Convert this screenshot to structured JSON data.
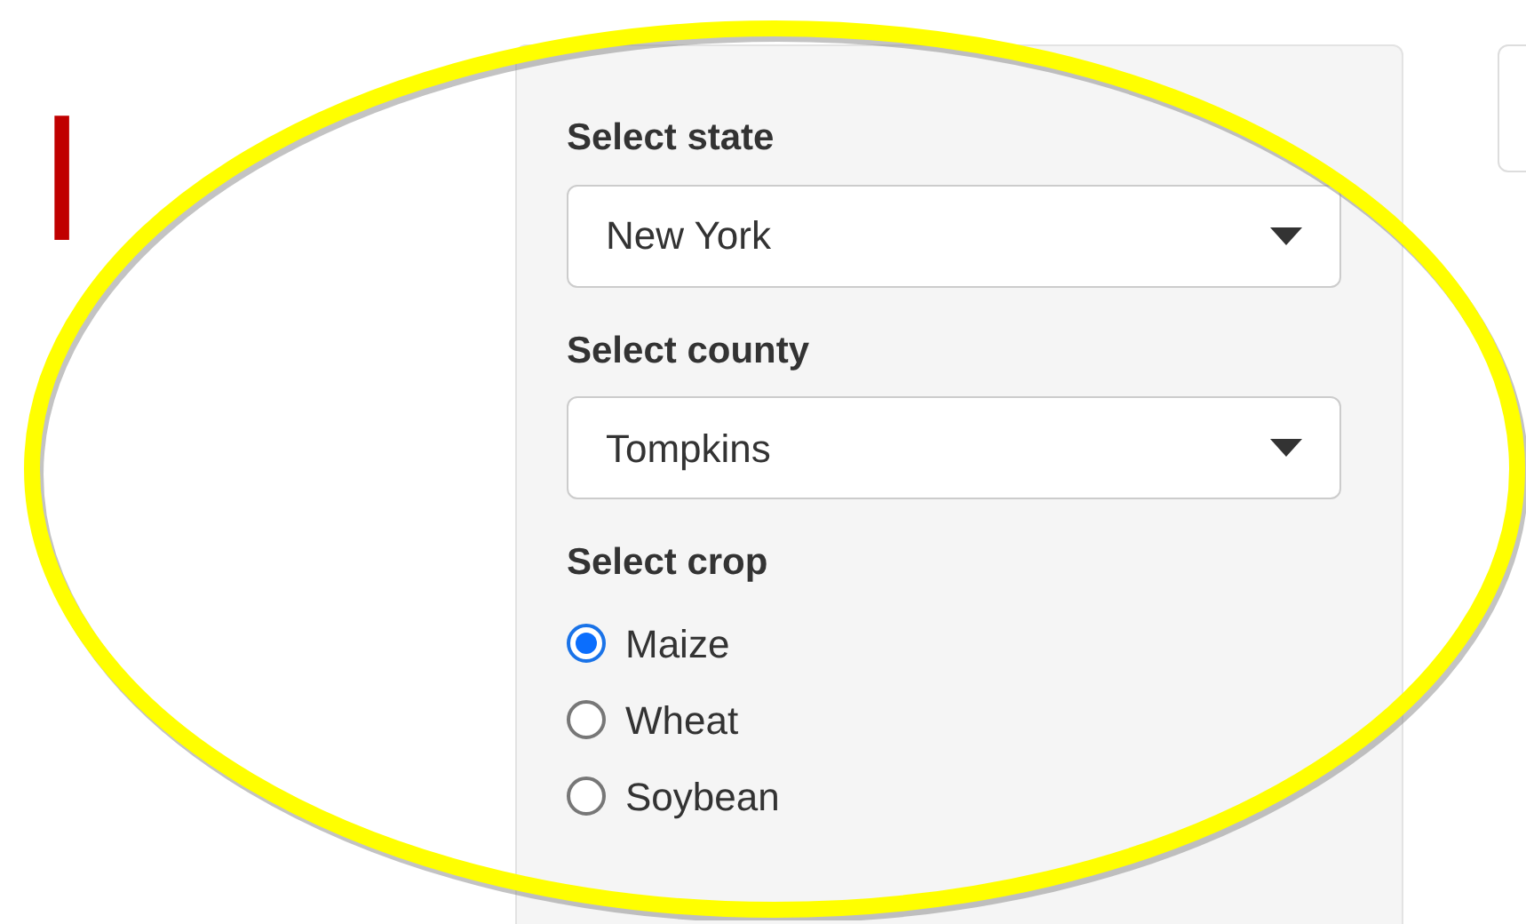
{
  "slide_title_fragment": "l",
  "inputs": [
    {
      "label": "Select state",
      "value": "New York"
    },
    {
      "label": "Select county",
      "value": "Tompkins"
    }
  ],
  "crop": {
    "label": "Select crop",
    "options": [
      {
        "label": "Maize",
        "selected": true
      },
      {
        "label": "Wheat",
        "selected": false
      },
      {
        "label": "Soybean",
        "selected": false
      }
    ]
  }
}
